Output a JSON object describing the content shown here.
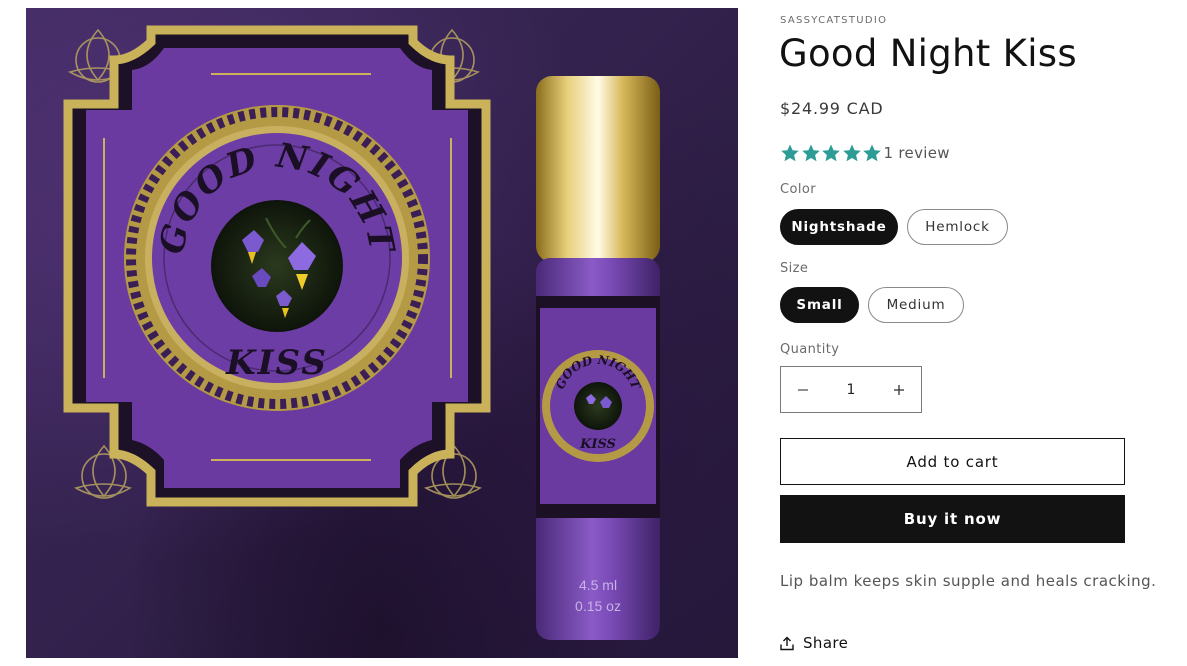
{
  "product": {
    "vendor": "SASSYCATSTUDIO",
    "title": "Good Night Kiss",
    "price": "$24.99 CAD",
    "rating": {
      "stars": 5,
      "max": 5,
      "review_count_label": "1 review"
    },
    "description": "Lip balm keeps skin supple and heals cracking."
  },
  "image": {
    "label_text_top": "GOOD NIGHT",
    "label_text_bottom": "KISS",
    "bottle_volume_ml": "4.5 ml",
    "bottle_volume_oz": "0.15 oz"
  },
  "options": {
    "color": {
      "label": "Color",
      "values": [
        "Nightshade",
        "Hemlock"
      ],
      "selected": "Nightshade"
    },
    "size": {
      "label": "Size",
      "values": [
        "Small",
        "Medium"
      ],
      "selected": "Small"
    }
  },
  "quantity": {
    "label": "Quantity",
    "value": "1"
  },
  "buttons": {
    "add_to_cart": "Add to cart",
    "buy_now": "Buy it now",
    "share": "Share"
  },
  "colors": {
    "star": "#2d9c96",
    "primary": "#121212",
    "label_purple": "#6a3a9e",
    "gold": "#c9b25a"
  },
  "icons": {
    "star": "star-icon",
    "minus": "minus-icon",
    "plus": "plus-icon",
    "share": "share-icon"
  }
}
